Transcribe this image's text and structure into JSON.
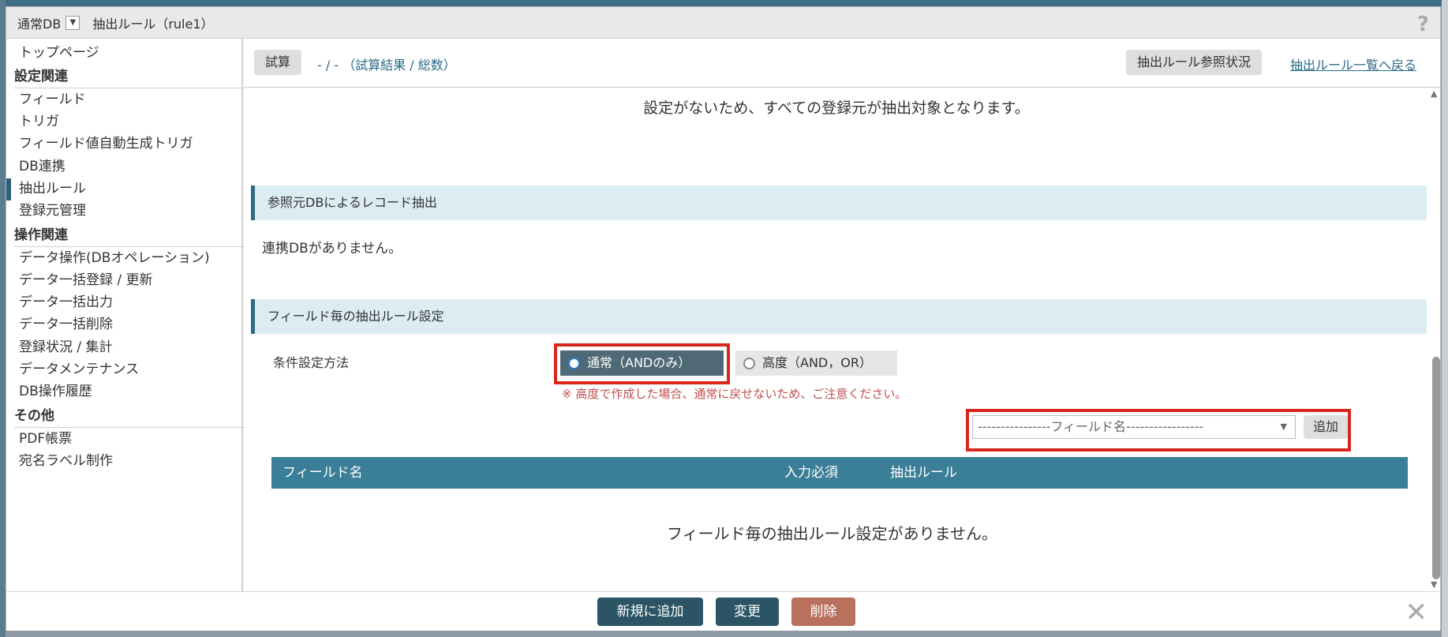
{
  "titlebar": {
    "db_select": "通常DB",
    "title": "抽出ルール（rule1）"
  },
  "sidebar": {
    "top": "トップページ",
    "section_settings": "設定関連",
    "settings_items": [
      "フィールド",
      "トリガ",
      "フィールド値自動生成トリガ",
      "DB連携",
      "抽出ルール",
      "登録元管理"
    ],
    "section_ops": "操作関連",
    "ops_items": [
      "データ操作(DBオペレーション)",
      "データ一括登録 / 更新",
      "データ一括出力",
      "データ一括削除",
      "登録状況 / 集計",
      "データメンテナンス",
      "DB操作履歴"
    ],
    "section_other": "その他",
    "other_items": [
      "PDF帳票",
      "宛名ラベル制作"
    ]
  },
  "toolbar": {
    "trial_button": "試算",
    "trial_result": "- / - （試算結果 / 総数）",
    "ref_status_button": "抽出ルール参照状況",
    "back_link": "抽出ルール一覧へ戻る"
  },
  "content": {
    "no_setting_notice": "設定がないため、すべての登録元が抽出対象となります。",
    "ref_db_section": "参照元DBによるレコード抽出",
    "no_linked_db": "連携DBがありません。",
    "field_rule_section": "フィールド毎の抽出ルール設定",
    "condition_method_label": "条件設定方法",
    "radio_normal": "通常（ANDのみ）",
    "radio_advanced": "高度（AND，OR）",
    "warning": "※ 高度で作成した場合、通常に戻せないため、ご注意ください。",
    "field_select_placeholder": "----------------フィールド名-----------------",
    "add_button": "追加",
    "table_headers": [
      "フィールド名",
      "入力必須",
      "抽出ルール"
    ],
    "empty_message": "フィールド毎の抽出ルール設定がありません。"
  },
  "footer": {
    "new_button": "新規に追加",
    "change_button": "変更",
    "delete_button": "削除"
  },
  "colors": {
    "accent": "#2f6a85",
    "table_head": "#3a7e97",
    "section_bg": "#dcecf3",
    "warning": "#c0504d",
    "highlight_frame": "#d9261c",
    "delete_button": "#b9715e",
    "primary_button": "#2b5465"
  }
}
